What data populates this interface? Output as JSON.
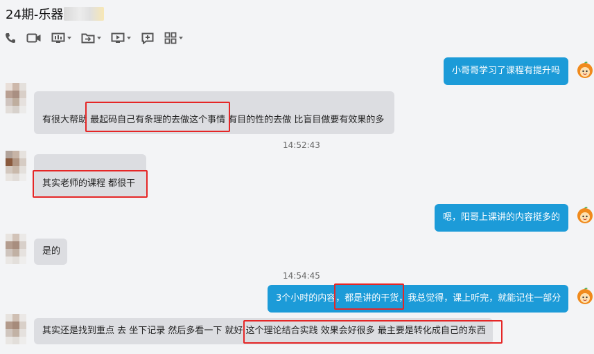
{
  "header": {
    "title": "24期-乐器"
  },
  "toolbar": {
    "icons": [
      "phone-icon",
      "video-camera-icon",
      "screen-share-icon",
      "folder-transfer-icon",
      "remote-desktop-icon",
      "add-window-icon",
      "apps-grid-icon"
    ]
  },
  "messages": [
    {
      "side": "out",
      "text": "小哥哥学习了课程有提升吗"
    },
    {
      "side": "in",
      "text": "有很大帮助 最起码自己有条理的去做这个事情 有目的性的去做 比盲目做要有效果的多"
    },
    {
      "side": "time",
      "text": "14:52:43"
    },
    {
      "side": "in",
      "text": "其实老师的课程 都很干"
    },
    {
      "side": "out",
      "text": "嗯，阳哥上课讲的内容挺多的"
    },
    {
      "side": "in",
      "text": "是的"
    },
    {
      "side": "time",
      "text": "14:54:45"
    },
    {
      "side": "out",
      "text": "3个小时的内容，都是讲的干货，我总觉得，课上听完，就能记住一部分"
    },
    {
      "side": "in",
      "text": "其实还是找到重点 去 坐下记录 然后多看一下 就好 这个理论结合实践 效果会好很多 最主要是转化成自己的东西"
    }
  ],
  "colors": {
    "outgoing_bubble": "#1c9bd8",
    "incoming_bubble": "#dcdde1",
    "highlight": "#e52626"
  }
}
